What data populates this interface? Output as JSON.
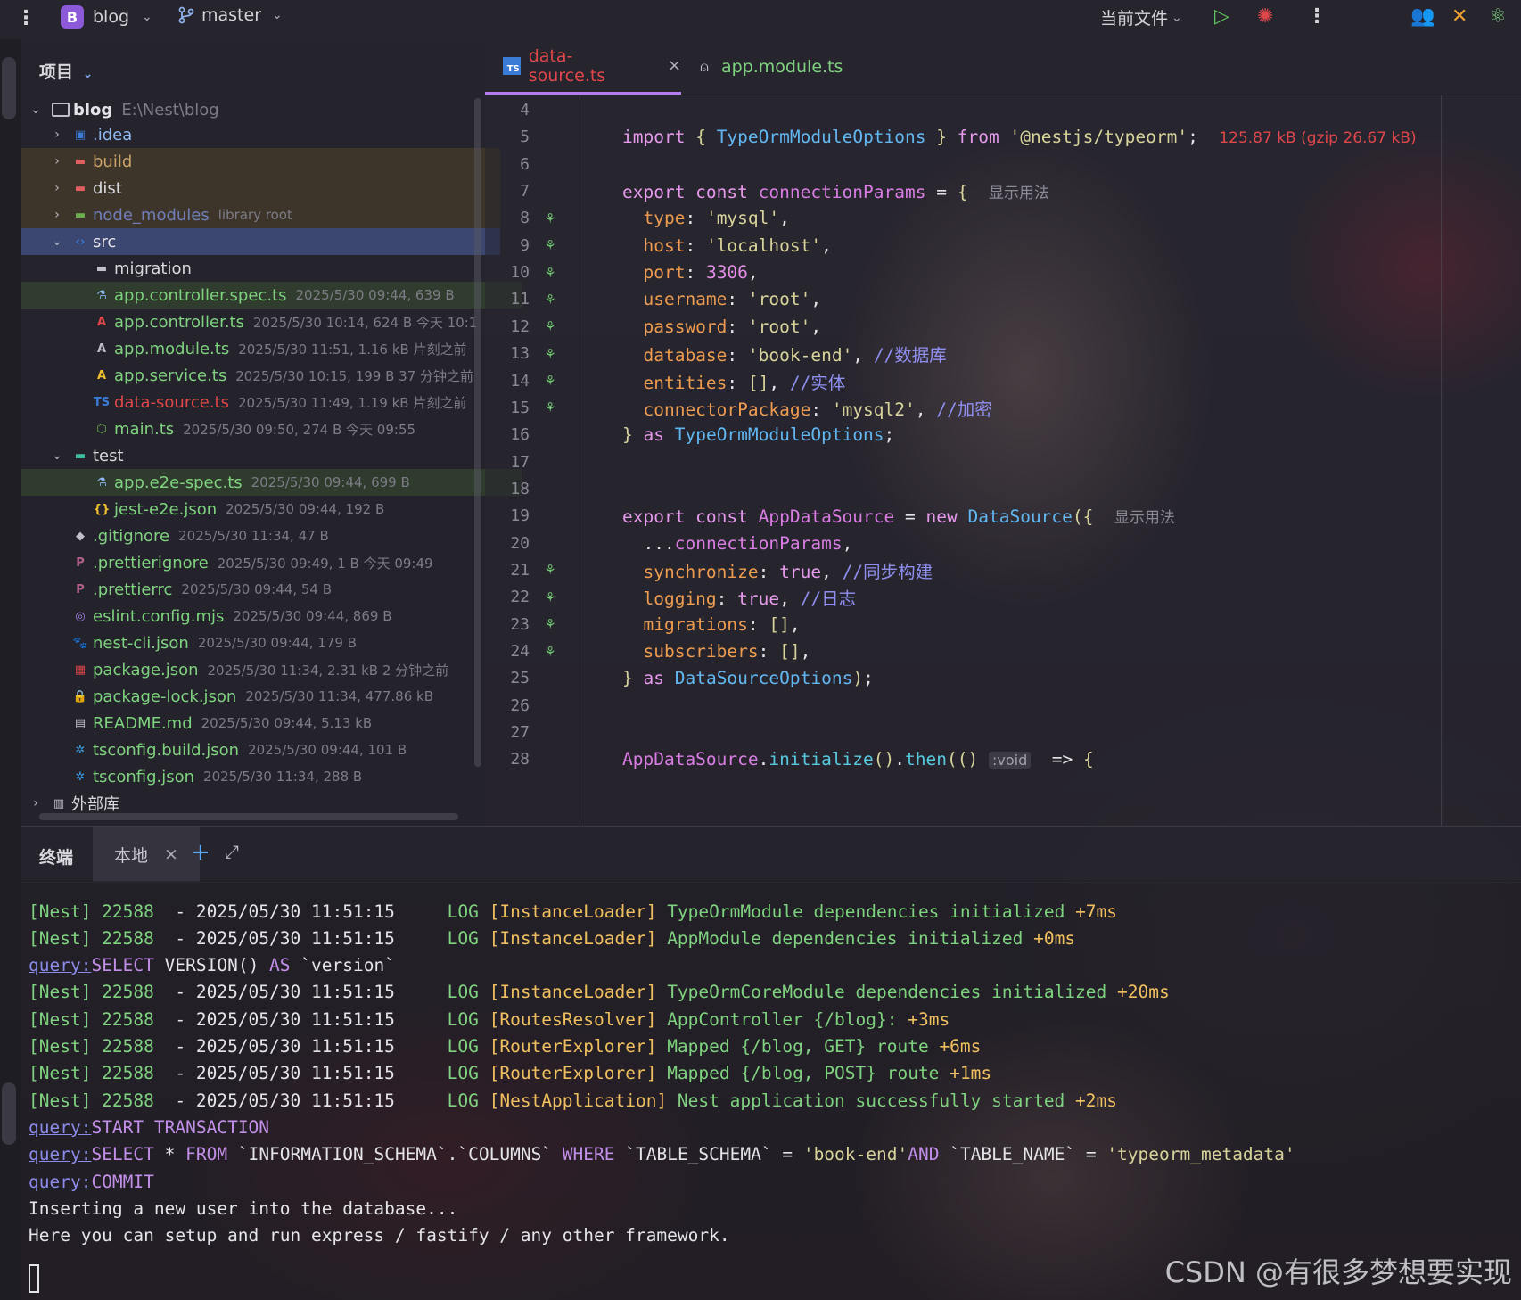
{
  "titlebar": {
    "project_letter": "B",
    "project_name": "blog",
    "branch": "master",
    "run_config": "当前文件"
  },
  "sidebar": {
    "header": "项目",
    "root": {
      "name": "blog",
      "path": "E:\\Nest\\blog"
    },
    "items": [
      {
        "name": ".idea",
        "meta": ""
      },
      {
        "name": "build",
        "meta": ""
      },
      {
        "name": "dist",
        "meta": ""
      },
      {
        "name": "node_modules",
        "meta": "library root"
      },
      {
        "name": "src",
        "meta": ""
      },
      {
        "name": "migration",
        "meta": ""
      },
      {
        "name": "app.controller.spec.ts",
        "meta": "2025/5/30 09:44, 639 B"
      },
      {
        "name": "app.controller.ts",
        "meta": "2025/5/30 10:14, 624 B 今天 10:1"
      },
      {
        "name": "app.module.ts",
        "meta": "2025/5/30 11:51, 1.16 kB 片刻之前"
      },
      {
        "name": "app.service.ts",
        "meta": "2025/5/30 10:15, 199 B 37 分钟之前"
      },
      {
        "name": "data-source.ts",
        "meta": "2025/5/30 11:49, 1.19 kB 片刻之前"
      },
      {
        "name": "main.ts",
        "meta": "2025/5/30 09:50, 274 B 今天 09:55"
      },
      {
        "name": "test",
        "meta": ""
      },
      {
        "name": "app.e2e-spec.ts",
        "meta": "2025/5/30 09:44, 699 B"
      },
      {
        "name": "jest-e2e.json",
        "meta": "2025/5/30 09:44, 192 B"
      },
      {
        "name": ".gitignore",
        "meta": "2025/5/30 11:34, 47 B"
      },
      {
        "name": ".prettierignore",
        "meta": "2025/5/30 09:49, 1 B 今天 09:49"
      },
      {
        "name": ".prettierrc",
        "meta": "2025/5/30 09:44, 54 B"
      },
      {
        "name": "eslint.config.mjs",
        "meta": "2025/5/30 09:44, 869 B"
      },
      {
        "name": "nest-cli.json",
        "meta": "2025/5/30 09:44, 179 B"
      },
      {
        "name": "package.json",
        "meta": "2025/5/30 11:34, 2.31 kB 2 分钟之前"
      },
      {
        "name": "package-lock.json",
        "meta": "2025/5/30 11:34, 477.86 kB"
      },
      {
        "name": "README.md",
        "meta": "2025/5/30 09:44, 5.13 kB"
      },
      {
        "name": "tsconfig.build.json",
        "meta": "2025/5/30 09:44, 101 B"
      },
      {
        "name": "tsconfig.json",
        "meta": "2025/5/30 11:34, 288 B"
      },
      {
        "name": "外部库",
        "meta": ""
      }
    ]
  },
  "editor": {
    "tabs": [
      {
        "label": "data-source.ts",
        "active": true
      },
      {
        "label": "app.module.ts",
        "active": false
      }
    ],
    "line_numbers": [
      "4",
      "5",
      "6",
      "7",
      "8",
      "9",
      "10",
      "11",
      "12",
      "13",
      "14",
      "15",
      "16",
      "17",
      "18",
      "19",
      "20",
      "21",
      "22",
      "23",
      "24",
      "25",
      "26",
      "27",
      "28"
    ],
    "import_size": "125.87 kB (gzip 26.67 kB)",
    "usage_hint": "显示用法",
    "void_hint": ":void",
    "comments": {
      "db": "//数据库",
      "entity": "//实体",
      "encrypt": "//加密",
      "sync": "//同步构建",
      "log": "//日志"
    }
  },
  "terminal": {
    "title": "终端",
    "tab": "本地",
    "lines": [
      {
        "pid": "[Nest] 22588",
        "time": "  - 2025/05/30 11:51:15     ",
        "level": "LOG ",
        "ctx": "[InstanceLoader] ",
        "msg": "TypeOrmModule dependencies initialized ",
        "ms": "+7ms"
      },
      {
        "pid": "[Nest] 22588",
        "time": "  - 2025/05/30 11:51:15     ",
        "level": "LOG ",
        "ctx": "[InstanceLoader] ",
        "msg": "AppModule dependencies initialized ",
        "ms": "+0ms"
      },
      {
        "pid": "[Nest] 22588",
        "time": "  - 2025/05/30 11:51:15     ",
        "level": "LOG ",
        "ctx": "[InstanceLoader] ",
        "msg": "TypeOrmCoreModule dependencies initialized ",
        "ms": "+20ms"
      },
      {
        "pid": "[Nest] 22588",
        "time": "  - 2025/05/30 11:51:15     ",
        "level": "LOG ",
        "ctx": "[RoutesResolver] ",
        "msg": "AppController {/blog}: ",
        "ms": "+3ms"
      },
      {
        "pid": "[Nest] 22588",
        "time": "  - 2025/05/30 11:51:15     ",
        "level": "LOG ",
        "ctx": "[RouterExplorer] ",
        "msg": "Mapped {/blog, GET} route ",
        "ms": "+6ms"
      },
      {
        "pid": "[Nest] 22588",
        "time": "  - 2025/05/30 11:51:15     ",
        "level": "LOG ",
        "ctx": "[RouterExplorer] ",
        "msg": "Mapped {/blog, POST} route ",
        "ms": "+1ms"
      },
      {
        "pid": "[Nest] 22588",
        "time": "  - 2025/05/30 11:51:15     ",
        "level": "LOG ",
        "ctx": "[NestApplication] ",
        "msg": "Nest application successfully started ",
        "ms": "+2ms"
      }
    ],
    "query_label": "query:",
    "insert_msg": "Inserting a new user into the database...",
    "setup_msg": "Here you can setup and run express / fastify / any other framework."
  },
  "watermark": "CSDN @有很多梦想要实现"
}
